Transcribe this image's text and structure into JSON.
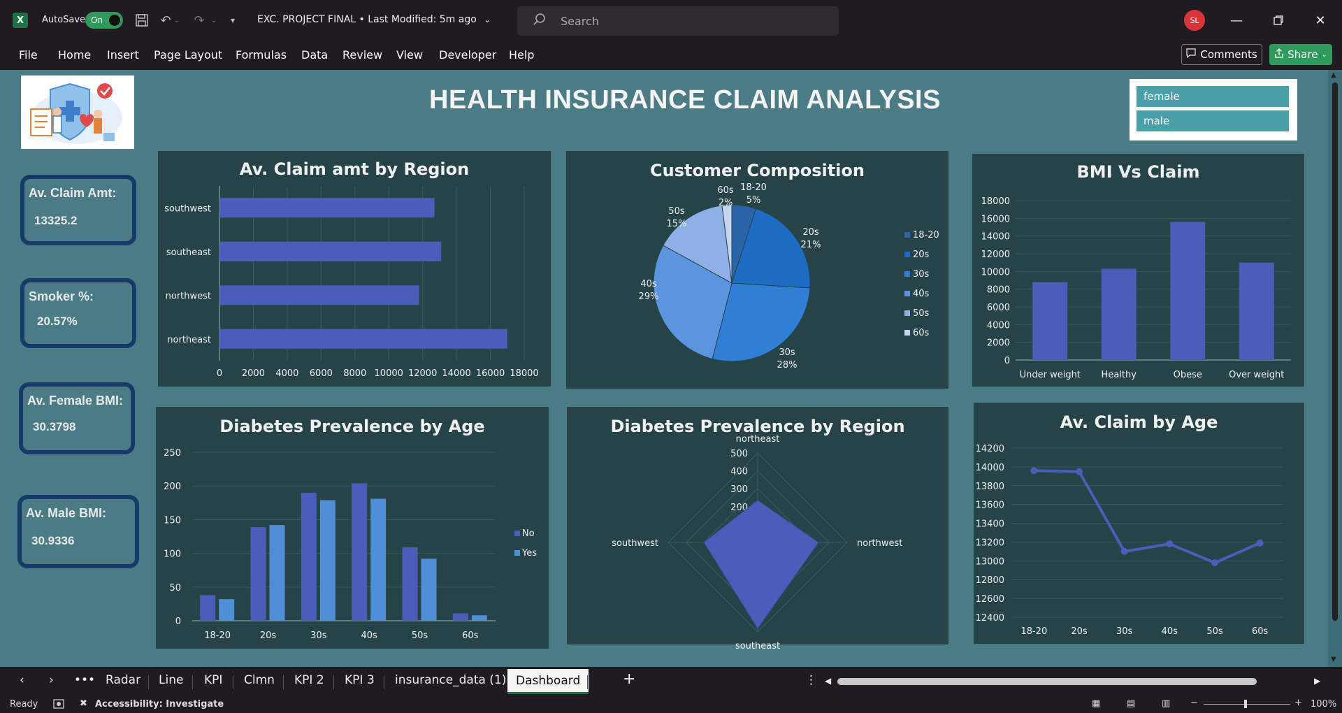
{
  "app": {
    "logo": "X",
    "autosave_label": "AutoSave",
    "autosave_state": "On",
    "doc_title": "EXC. PROJECT FINAL • Last Modified: 5m ago",
    "search_placeholder": "Search",
    "user_initials": "SL",
    "accent_color": "#2e9b5c"
  },
  "menu": {
    "items": [
      "File",
      "Home",
      "Insert",
      "Page Layout",
      "Formulas",
      "Data",
      "Review",
      "View",
      "Developer",
      "Help"
    ],
    "comments_label": "Comments",
    "share_label": "Share"
  },
  "dashboard": {
    "title": "HEALTH INSURANCE CLAIM ANALYSIS",
    "slicer": [
      "female",
      "male"
    ],
    "kpis": [
      {
        "label": "Av. Claim Amt:",
        "value": "13325.2"
      },
      {
        "label": "Smoker %:",
        "value": "20.57%"
      },
      {
        "label": "Av. Female BMI:",
        "value": "30.3798"
      },
      {
        "label": "Av. Male BMI:",
        "value": "30.9336"
      }
    ]
  },
  "chart_data": [
    {
      "type": "bar",
      "orientation": "horizontal",
      "title": "Av. Claim amt by Region",
      "categories": [
        "southwest",
        "southeast",
        "northwest",
        "northeast"
      ],
      "values": [
        12700,
        13100,
        11800,
        17000
      ],
      "xlim": [
        0,
        18000
      ],
      "ticks": [
        "0",
        "2000",
        "4000",
        "6000",
        "8000",
        "10000",
        "12000",
        "14000",
        "16000",
        "18000"
      ],
      "color": "#4a5db8"
    },
    {
      "type": "pie",
      "title": "Customer Composition",
      "slices": [
        {
          "label": "18-20",
          "pct": "5%",
          "value": 5,
          "color": "#2b63a8"
        },
        {
          "label": "20s",
          "pct": "21%",
          "value": 21,
          "color": "#1d6cc4"
        },
        {
          "label": "30s",
          "pct": "28%",
          "value": 28,
          "color": "#2f7fd6"
        },
        {
          "label": "40s",
          "pct": "29%",
          "value": 29,
          "color": "#5b95e0"
        },
        {
          "label": "50s",
          "pct": "15%",
          "value": 15,
          "color": "#8fb0e6"
        },
        {
          "label": "60s",
          "pct": "2%",
          "value": 2,
          "color": "#c5d5f0"
        }
      ],
      "legend": [
        "18-20",
        "20s",
        "30s",
        "40s",
        "50s",
        "60s"
      ]
    },
    {
      "type": "bar",
      "title": "BMI Vs Claim",
      "categories": [
        "Under weight",
        "Healthy",
        "Obese",
        "Over weight"
      ],
      "values": [
        8800,
        10300,
        15600,
        11000
      ],
      "ylim": [
        0,
        18000
      ],
      "ticks": [
        "0",
        "2000",
        "4000",
        "6000",
        "8000",
        "10000",
        "12000",
        "14000",
        "16000",
        "18000"
      ],
      "color": "#4a5db8"
    },
    {
      "type": "bar",
      "title": "Diabetes Prevalence by Age",
      "categories": [
        "18-20",
        "20s",
        "30s",
        "40s",
        "50s",
        "60s"
      ],
      "series": [
        {
          "name": "No",
          "values": [
            38,
            139,
            190,
            204,
            109,
            11
          ],
          "color": "#4a5db8"
        },
        {
          "name": "Yes",
          "values": [
            32,
            142,
            179,
            181,
            92,
            8
          ],
          "color": "#4f8fd6"
        }
      ],
      "ylim": [
        0,
        250
      ],
      "ticks": [
        "0",
        "50",
        "100",
        "150",
        "200",
        "250"
      ]
    },
    {
      "type": "radar",
      "title": "Diabetes Prevalence by Region",
      "axes": [
        "northeast",
        "northwest",
        "southeast",
        "southwest"
      ],
      "values": [
        235,
        340,
        480,
        300
      ],
      "rlim": [
        0,
        500
      ],
      "ticks": [
        "0",
        "100",
        "200",
        "300",
        "400",
        "500"
      ],
      "color": "#4a5db8"
    },
    {
      "type": "line",
      "title": "Av. Claim by Age",
      "categories": [
        "18-20",
        "20s",
        "30s",
        "40s",
        "50s",
        "60s"
      ],
      "values": [
        13960,
        13950,
        13100,
        13180,
        12980,
        13190
      ],
      "ylim": [
        12400,
        14200
      ],
      "ticks": [
        "12400",
        "12600",
        "12800",
        "13000",
        "13200",
        "13400",
        "13600",
        "13800",
        "14000",
        "14200"
      ],
      "color": "#4a5db8"
    }
  ],
  "tabs": {
    "items": [
      "Radar",
      "Line",
      "KPI",
      "Clmn",
      "KPI 2",
      "KPI 3",
      "insurance_data (1)",
      "Dashboard"
    ],
    "active": "Dashboard"
  },
  "status": {
    "ready": "Ready",
    "accessibility": "Accessibility: Investigate",
    "zoom": "100%"
  }
}
